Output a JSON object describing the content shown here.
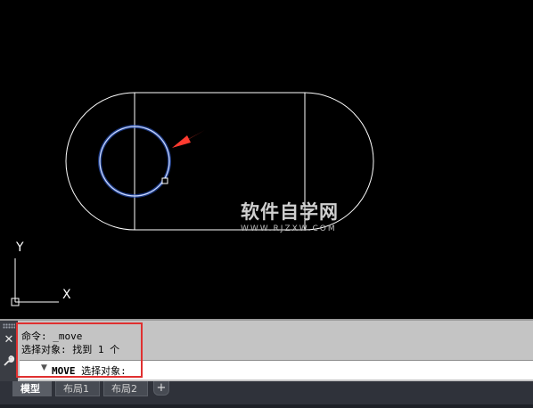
{
  "drawing": {
    "axis_y_label": "Y",
    "axis_x_label": "X",
    "watermark_main": "软件自学网",
    "watermark_sub": "WWW.RJZXW.COM",
    "colors": {
      "background": "#000000",
      "geometry": "#ffffff",
      "selected_circle": "#6e9bff",
      "arrow": "#ff3b30"
    }
  },
  "command": {
    "history": [
      "命令: _move",
      "选择对象: 找到 1 个"
    ],
    "prompt_command": "MOVE",
    "prompt_text": "选择对象:",
    "close_icon": "close-icon",
    "settings_icon": "wrench-icon"
  },
  "tabs": [
    {
      "label": "模型",
      "active": true
    },
    {
      "label": "布局1",
      "active": false
    },
    {
      "label": "布局2",
      "active": false
    }
  ],
  "tab_add_label": "+"
}
